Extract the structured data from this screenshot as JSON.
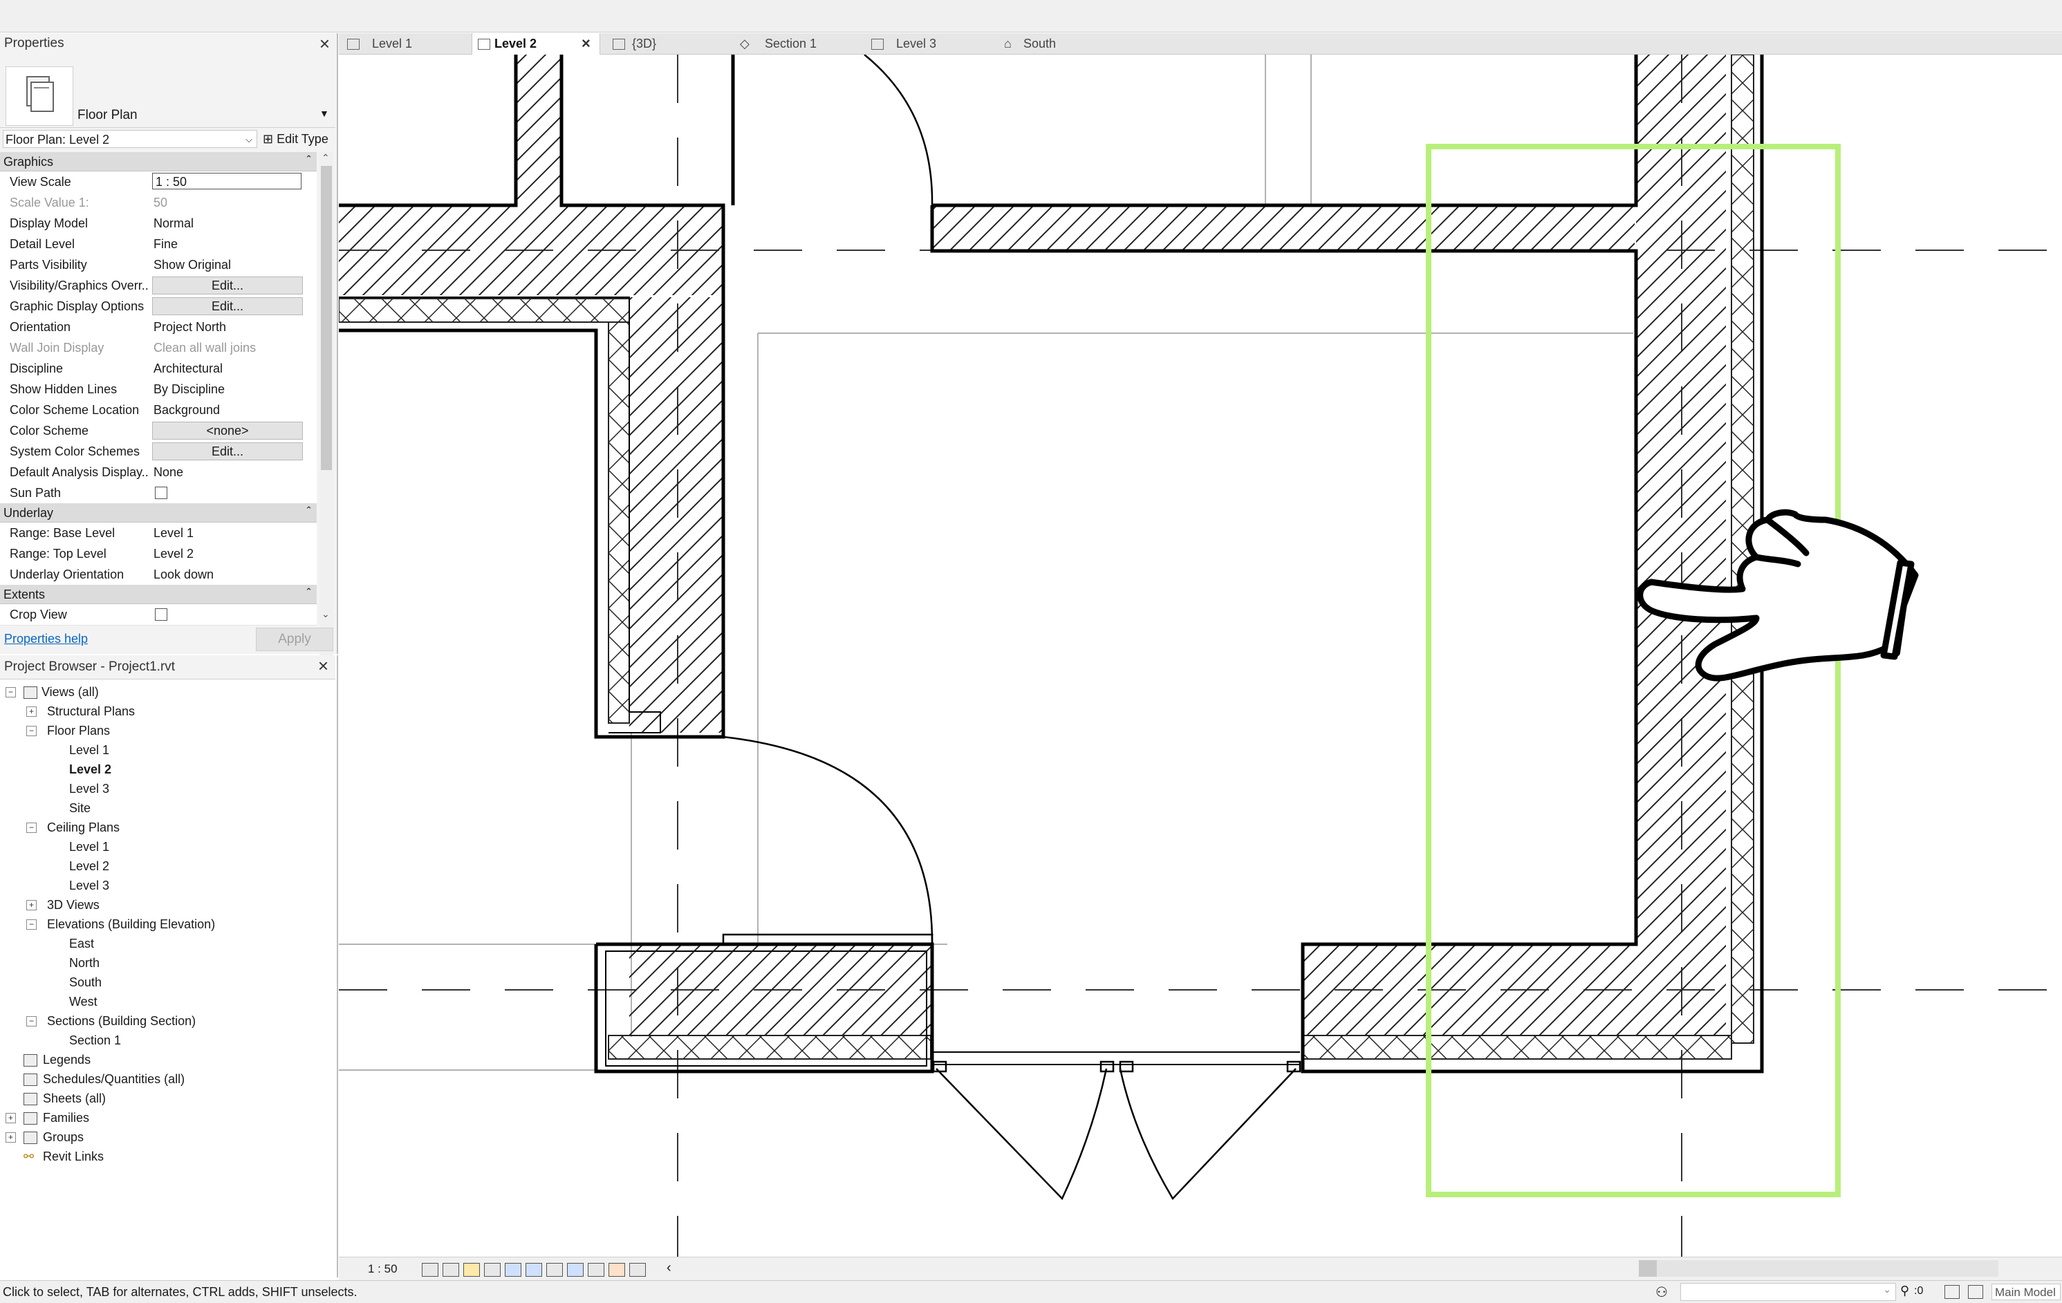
{
  "properties": {
    "title": "Properties",
    "type_name": "Floor Plan",
    "view_selector": "Floor Plan: Level 2",
    "edit_type": "Edit Type",
    "groups": {
      "graphics": "Graphics",
      "underlay": "Underlay",
      "extents": "Extents"
    },
    "rows": {
      "view_scale": {
        "label": "View Scale",
        "value": "1 : 50"
      },
      "scale_value": {
        "label": "Scale Value    1:",
        "value": "50"
      },
      "display_model": {
        "label": "Display Model",
        "value": "Normal"
      },
      "detail_level": {
        "label": "Detail Level",
        "value": "Fine"
      },
      "parts_visibility": {
        "label": "Parts Visibility",
        "value": "Show Original"
      },
      "vg_overrides": {
        "label": "Visibility/Graphics Overr...",
        "value": "Edit..."
      },
      "graphic_display": {
        "label": "Graphic Display Options",
        "value": "Edit..."
      },
      "orientation": {
        "label": "Orientation",
        "value": "Project North"
      },
      "wall_join": {
        "label": "Wall Join Display",
        "value": "Clean all wall joins"
      },
      "discipline": {
        "label": "Discipline",
        "value": "Architectural"
      },
      "hidden_lines": {
        "label": "Show Hidden Lines",
        "value": "By Discipline"
      },
      "color_scheme_loc": {
        "label": "Color Scheme Location",
        "value": "Background"
      },
      "color_scheme": {
        "label": "Color Scheme",
        "value": "<none>"
      },
      "system_color": {
        "label": "System Color Schemes",
        "value": "Edit..."
      },
      "default_analysis": {
        "label": "Default Analysis Display...",
        "value": "None"
      },
      "sun_path": {
        "label": "Sun Path"
      },
      "base_level": {
        "label": "Range: Base Level",
        "value": "Level 1"
      },
      "top_level": {
        "label": "Range: Top Level",
        "value": "Level 2"
      },
      "underlay_orient": {
        "label": "Underlay Orientation",
        "value": "Look down"
      },
      "crop_view": {
        "label": "Crop View"
      }
    },
    "help_link": "Properties help",
    "apply": "Apply"
  },
  "browser": {
    "title": "Project Browser - Project1.rvt",
    "items": {
      "views_all": "Views (all)",
      "structural_plans": "Structural Plans",
      "floor_plans": "Floor Plans",
      "fp_level1": "Level 1",
      "fp_level2": "Level 2",
      "fp_level3": "Level 3",
      "fp_site": "Site",
      "ceiling_plans": "Ceiling Plans",
      "cp_level1": "Level 1",
      "cp_level2": "Level 2",
      "cp_level3": "Level 3",
      "views_3d": "3D Views",
      "elevations": "Elevations (Building Elevation)",
      "east": "East",
      "north": "North",
      "south": "South",
      "west": "West",
      "sections": "Sections (Building Section)",
      "section1": "Section 1",
      "legends": "Legends",
      "schedules": "Schedules/Quantities (all)",
      "sheets": "Sheets (all)",
      "families": "Families",
      "groups": "Groups",
      "revit_links": "Revit Links"
    }
  },
  "tabs": [
    "Level 1",
    "Level 2",
    "{3D}",
    "Section 1",
    "Level 3",
    "South"
  ],
  "view_control": {
    "scale": "1 : 50"
  },
  "status": {
    "message": "Click to select, TAB for alternates, CTRL adds, SHIFT unselects.",
    "count": ":0",
    "model": "Main Model"
  },
  "colors": {
    "selection_box": "#b8ef7a",
    "wall_line": "#000000"
  }
}
